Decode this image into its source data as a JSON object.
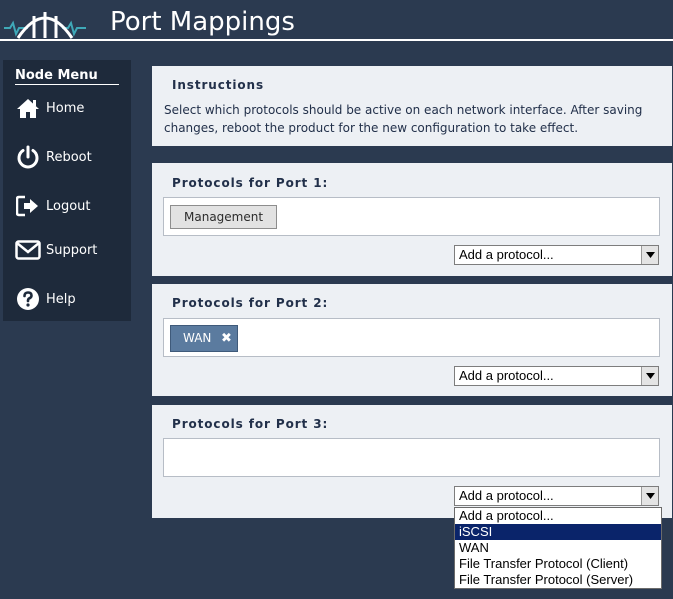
{
  "header": {
    "title": "Port Mappings"
  },
  "sidebar": {
    "title": "Node Menu",
    "items": [
      {
        "label": "Home",
        "icon": "home-icon"
      },
      {
        "label": "Reboot",
        "icon": "power-icon"
      },
      {
        "label": "Logout",
        "icon": "logout-icon"
      },
      {
        "label": "Support",
        "icon": "envelope-icon"
      },
      {
        "label": "Help",
        "icon": "help-icon"
      }
    ]
  },
  "instructions": {
    "title": "Instructions",
    "text": "Select which protocols should be active on each network interface. After saving changes, reboot the product for the new configuration to take effect."
  },
  "ports": [
    {
      "title": "Protocols for Port 1:",
      "tags": [
        "Management"
      ],
      "select_value": "Add a protocol..."
    },
    {
      "title": "Protocols for Port 2:",
      "tags": [
        "WAN"
      ],
      "select_value": "Add a protocol..."
    },
    {
      "title": "Protocols for Port 3:",
      "tags": [],
      "select_value": "Add a protocol..."
    }
  ],
  "tag_remove_glyph": "✖",
  "dropdown": {
    "options": [
      "Add a protocol...",
      "iSCSI",
      "WAN",
      "File Transfer Protocol (Client)",
      "File Transfer Protocol (Server)"
    ],
    "highlighted_index": 1
  },
  "colors": {
    "background": "#2b3a50",
    "sidebar": "#1e2a3b",
    "panel": "#edf0f4",
    "tag_active": "#5b7b9f",
    "logo_teal": "#3fa9b8"
  }
}
